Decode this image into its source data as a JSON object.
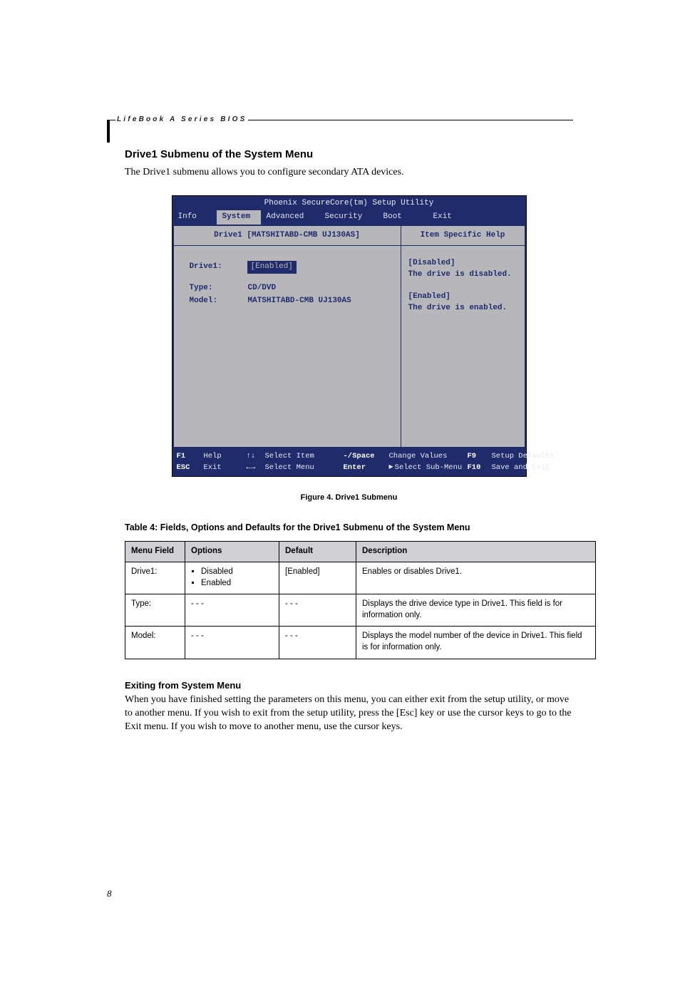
{
  "header": {
    "label": "LifeBook A Series BIOS"
  },
  "section": {
    "title": "Drive1 Submenu of the System Menu",
    "intro": "The Drive1 submenu allows you to configure secondary ATA devices."
  },
  "bios": {
    "title": "Phoenix SecureCore(tm) Setup Utility",
    "tabs": [
      "Info",
      "System",
      "Advanced",
      "Security",
      "Boot",
      "Exit"
    ],
    "active_tab_index": 1,
    "left_head": "Drive1 [MATSHITABD-CMB UJ130AS]",
    "right_head": "Item Specific Help",
    "fields": {
      "drive1": {
        "label": "Drive1:",
        "value": "[Enabled]",
        "selected": true
      },
      "type": {
        "label": "Type:",
        "value": "CD/DVD"
      },
      "model": {
        "label": "Model:",
        "value": "MATSHITABD-CMB UJ130AS"
      }
    },
    "help": [
      {
        "head": "[Disabled]",
        "body": "The drive is disabled."
      },
      {
        "head": "[Enabled]",
        "body": "The drive is enabled."
      }
    ],
    "footer": {
      "f1": "F1",
      "help": "Help",
      "updn_label": "Select Item",
      "valkeys": "-/Space",
      "valkeys_label": "Change Values",
      "f9": "F9",
      "f9_label": "Setup Defaults",
      "esc": "ESC",
      "exit": "Exit",
      "lr_label": "Select Menu",
      "enter": "Enter",
      "enter_label": "Select    Sub-Menu",
      "f10": "F10",
      "f10_label": "Save and Exit"
    }
  },
  "figure_caption": "Figure 4.  Drive1 Submenu",
  "table_caption": "Table 4: Fields, Options and Defaults for the Drive1 Submenu of the System Menu",
  "table": {
    "headers": [
      "Menu Field",
      "Options",
      "Default",
      "Description"
    ],
    "rows": [
      {
        "field": "Drive1:",
        "options": [
          "Disabled",
          "Enabled"
        ],
        "default": "[Enabled]",
        "desc": "Enables or disables Drive1."
      },
      {
        "field": "Type:",
        "options_text": "- - -",
        "default": "- - -",
        "desc": "Displays the drive device type in Drive1. This field is for information only."
      },
      {
        "field": "Model:",
        "options_text": "- - -",
        "default": "- - -",
        "desc": "Displays the model number of the device in Drive1. This field is for information only."
      }
    ]
  },
  "exit": {
    "title": "Exiting from System Menu",
    "body": "When you have finished setting the parameters on this menu, you can either exit from the setup utility, or move to another menu. If you wish to exit from the setup utility, press the [Esc] key or use the cursor keys to go to the Exit menu. If you wish to move to another menu, use the cursor keys."
  },
  "page_number": "8"
}
